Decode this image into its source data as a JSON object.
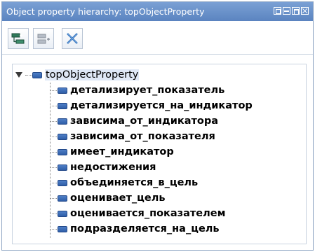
{
  "window": {
    "title": "Object property hierarchy: topObjectProperty"
  },
  "toolbar": {
    "buttons": [
      {
        "icon": "add-subproperty-icon"
      },
      {
        "icon": "add-sibling-property-icon"
      },
      {
        "icon": "delete-property-icon"
      }
    ]
  },
  "tree": {
    "root": {
      "label": "topObjectProperty"
    },
    "children": [
      "детализирует_показатель",
      "детализируется_на_индикатор",
      "зависима_от_индикатора",
      "зависима_от_показателя",
      "имеет_индикатор",
      "недостижения",
      "объединяется_в_цель",
      "оценивает_цель",
      "оценивается_показателем",
      "подразделяется_на_цель"
    ]
  },
  "colors": {
    "titlebar": "#5b84c0",
    "property_icon": "#2f5ea8",
    "selection": "#dfe8f6"
  }
}
